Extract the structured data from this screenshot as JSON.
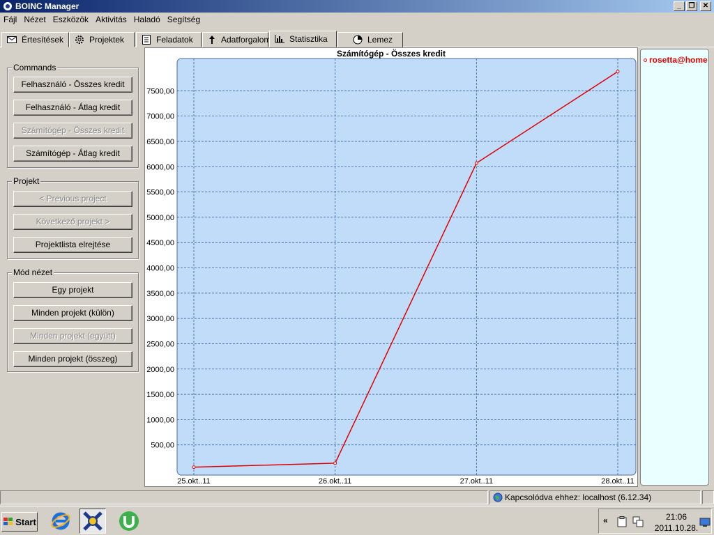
{
  "window": {
    "title": "BOINC Manager",
    "controls": [
      "_",
      "❐",
      "✕"
    ]
  },
  "menu": [
    "Fájl",
    "Nézet",
    "Eszközök",
    "Aktivitás",
    "Haladó",
    "Segítség"
  ],
  "tabs": [
    {
      "label": "Értesítések",
      "icon": "envelope-icon"
    },
    {
      "label": "Projektek",
      "icon": "gear-icon"
    },
    {
      "label": "Feladatok",
      "icon": "document-icon"
    },
    {
      "label": "Adatforgalom",
      "icon": "transfer-icon"
    },
    {
      "label": "Statisztika",
      "icon": "bar-chart-icon",
      "active": true
    },
    {
      "label": "Lemez",
      "icon": "disk-icon"
    }
  ],
  "commands": {
    "title": "Commands",
    "buttons": [
      {
        "label": "Felhasználó - Összes kredit",
        "disabled": false
      },
      {
        "label": "Felhasználó - Átlag kredit",
        "disabled": false
      },
      {
        "label": "Számítógép - Összes kredit",
        "disabled": true
      },
      {
        "label": "Számítógép - Átlag kredit",
        "disabled": false
      }
    ]
  },
  "projekt": {
    "title": "Projekt",
    "buttons": [
      {
        "label": "< Previous project",
        "disabled": true
      },
      {
        "label": "Következő projekt >",
        "disabled": true
      },
      {
        "label": "Projektlista elrejtése",
        "disabled": false
      }
    ]
  },
  "mode": {
    "title": "Mód nézet",
    "buttons": [
      {
        "label": "Egy projekt",
        "disabled": false
      },
      {
        "label": "Minden projekt (külön)",
        "disabled": false
      },
      {
        "label": "Minden projekt (együtt)",
        "disabled": true
      },
      {
        "label": "Minden projekt (összeg)",
        "disabled": false
      }
    ]
  },
  "legend": {
    "label": "rosetta@home",
    "color": "#e00000"
  },
  "chart_data": {
    "type": "line",
    "title": "Számítógép - Összes kredit",
    "x": [
      "25.okt..11",
      "26.okt..11",
      "27.okt..11",
      "28.okt..11"
    ],
    "series": [
      {
        "name": "rosetta@home",
        "values": [
          60,
          140,
          6070,
          7880
        ],
        "color": "#e00000"
      }
    ],
    "yticks": [
      "500,00",
      "1000,00",
      "1500,00",
      "2000,00",
      "2500,00",
      "3000,00",
      "3500,00",
      "4000,00",
      "4500,00",
      "5000,00",
      "5500,00",
      "6000,00",
      "6500,00",
      "7000,00",
      "7500,00"
    ],
    "ylim": [
      0,
      8000
    ],
    "grid": true,
    "background": "#c0dcf8"
  },
  "status": {
    "connection": "Kapcsolódva ehhez: localhost (6.12.34)"
  },
  "taskbar": {
    "start": "Start",
    "apps": [
      "internet-explorer-icon",
      "boinc-icon",
      "utorrent-icon"
    ],
    "clock_time": "21:06",
    "clock_date": "2011.10.28."
  }
}
